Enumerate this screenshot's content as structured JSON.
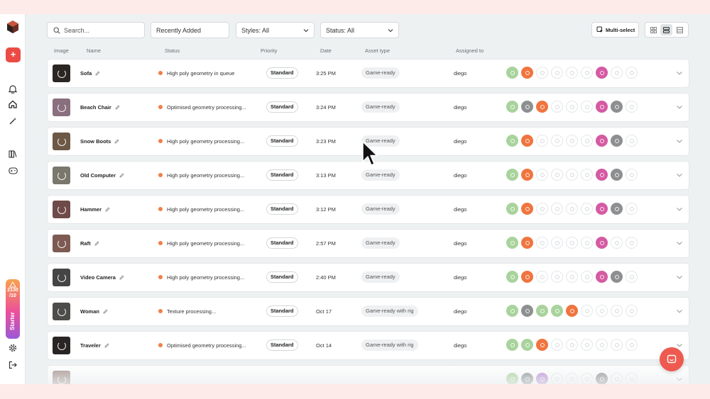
{
  "toolbar": {
    "search_placeholder": "Search...",
    "sort": "Recently Added",
    "styles": "Styles: All",
    "status": "Status: All",
    "multiselect": "Multi-select"
  },
  "columns": {
    "image": "Image",
    "name": "Name",
    "status": "Status",
    "priority": "Priority",
    "date": "Date",
    "asset_type": "Asset type",
    "assigned_to": "Assigned to"
  },
  "sidebar": {
    "credits_value": "2130 /10",
    "plan": "Starter"
  },
  "colors": {
    "accent": "#ec4b45",
    "status_dot": "#f07f47",
    "stage_green": "#a9d39c",
    "stage_orange": "#f0743f",
    "stage_pink": "#d55aa3",
    "stage_gray": "#8d8f91"
  },
  "rows": [
    {
      "name": "Sofa",
      "status": "High poly geometry in queue",
      "priority": "Standard",
      "date": "3:25 PM",
      "asset_type": "Game-ready",
      "assigned": "diego",
      "thumb": "#2b2624",
      "stages": [
        "green",
        "orange",
        "empty",
        "empty",
        "empty",
        "empty",
        "pink",
        "empty",
        "empty"
      ]
    },
    {
      "name": "Beach Chair",
      "status": "Optimised geometry processing...",
      "priority": "Standard",
      "date": "3:24 PM",
      "asset_type": "Game-ready",
      "assigned": "diego",
      "thumb": "#8a6f7e",
      "stages": [
        "green",
        "gray",
        "orange",
        "empty",
        "empty",
        "empty",
        "pink",
        "gray",
        "empty"
      ]
    },
    {
      "name": "Snow Boots",
      "status": "High poly geometry processing...",
      "priority": "Standard",
      "date": "3:23 PM",
      "asset_type": "Game-ready",
      "assigned": "diego",
      "thumb": "#6d5846",
      "stages": [
        "green",
        "orange",
        "empty",
        "empty",
        "empty",
        "empty",
        "pink",
        "gray",
        "empty"
      ]
    },
    {
      "name": "Old Computer",
      "status": "High poly geometry processing...",
      "priority": "Standard",
      "date": "3:13 PM",
      "asset_type": "Game-ready",
      "assigned": "diego",
      "thumb": "#7a776d",
      "stages": [
        "green",
        "orange",
        "empty",
        "empty",
        "empty",
        "empty",
        "pink",
        "gray",
        "empty"
      ]
    },
    {
      "name": "Hammer",
      "status": "High poly geometry processing...",
      "priority": "Standard",
      "date": "3:12 PM",
      "asset_type": "Game-ready",
      "assigned": "diego",
      "thumb": "#6e4b48",
      "stages": [
        "green",
        "orange",
        "empty",
        "empty",
        "empty",
        "empty",
        "pink",
        "gray",
        "empty"
      ]
    },
    {
      "name": "Raft",
      "status": "High poly geometry processing...",
      "priority": "Standard",
      "date": "2:57 PM",
      "asset_type": "Game-ready",
      "assigned": "diego",
      "thumb": "#7d5a52",
      "stages": [
        "green",
        "orange",
        "empty",
        "empty",
        "empty",
        "empty",
        "pink",
        "empty",
        "empty"
      ]
    },
    {
      "name": "Video Camera",
      "status": "High poly geometry processing...",
      "priority": "Standard",
      "date": "2:40 PM",
      "asset_type": "Game-ready",
      "assigned": "diego",
      "thumb": "#454545",
      "stages": [
        "green",
        "orange",
        "empty",
        "empty",
        "empty",
        "empty",
        "pink",
        "gray",
        "empty"
      ]
    },
    {
      "name": "Woman",
      "status": "Texture processing...",
      "priority": "Standard",
      "date": "Oct 17",
      "asset_type": "Game-ready with rig",
      "assigned": "diego",
      "thumb": "#4d4c4a",
      "stages": [
        "green",
        "gray",
        "green",
        "green",
        "orange",
        "empty",
        "empty",
        "empty",
        "empty"
      ]
    },
    {
      "name": "Traveler",
      "status": "Optimised geometry processing...",
      "priority": "Standard",
      "date": "Oct 14",
      "asset_type": "Game-ready with rig",
      "assigned": "diego",
      "thumb": "#282524",
      "stages": [
        "green",
        "green",
        "orange",
        "empty",
        "empty",
        "empty",
        "empty",
        "empty",
        "empty"
      ]
    },
    {
      "name": "",
      "status": "",
      "priority": "",
      "date": "",
      "asset_type": "",
      "assigned": "",
      "thumb": "#a2908a",
      "stages": [
        "green",
        "gray",
        "purple",
        "empty",
        "empty",
        "empty",
        "gray",
        "empty",
        "empty"
      ]
    }
  ]
}
